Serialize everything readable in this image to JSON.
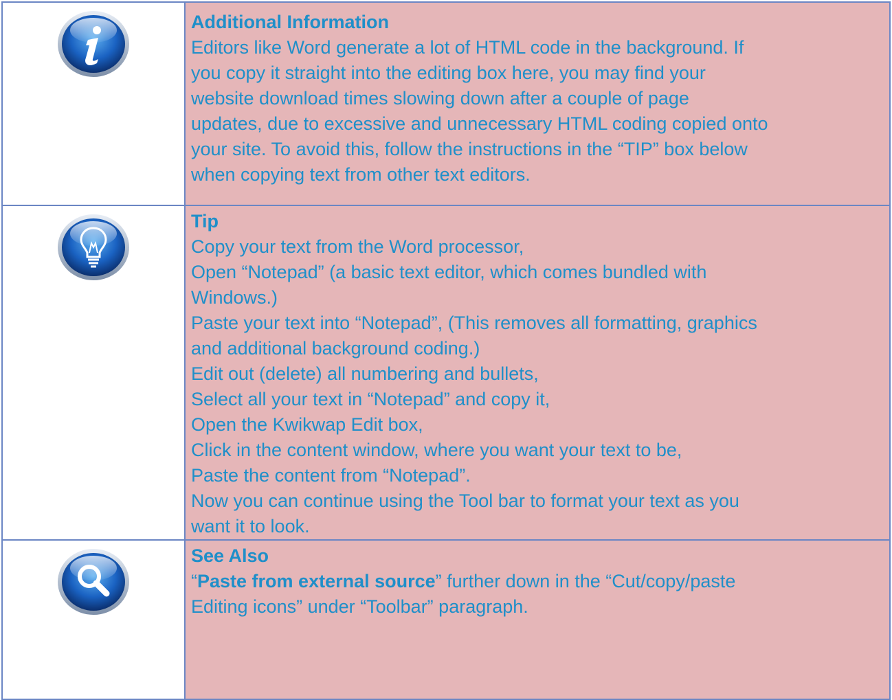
{
  "rows": [
    {
      "icon": "info-icon",
      "heading": "Additional Information",
      "lines": [
        "Editors like Word generate a lot of HTML code in the background. If",
        "you copy it straight into the editing box here, you may find your",
        "website download times slowing down after a couple of page",
        "updates, due to excessive and unnecessary HTML coding copied onto",
        "your site. To avoid this, follow the instructions in the “TIP” box below",
        "when copying text from other text editors."
      ]
    },
    {
      "icon": "lightbulb-icon",
      "heading": "Tip",
      "lines": [
        "Copy your text from the Word processor,",
        "Open “Notepad” (a basic text editor, which comes bundled with",
        "Windows.)",
        "Paste your text into “Notepad”, (This removes all formatting, graphics",
        "and additional background coding.)",
        "Edit out (delete) all numbering and bullets,",
        "Select all your text in “Notepad” and copy it,",
        "Open the Kwikwap Edit box,",
        "Click in the content window, where you want your text to be,",
        "Paste the content from “Notepad”.",
        "Now you can continue using the Tool bar to format your text as you",
        "want it to look."
      ]
    },
    {
      "icon": "magnifier-icon",
      "heading": "See Also",
      "line1_open_quote": "“",
      "line1_bold": "Paste from external source",
      "line1_rest": "” further down in the “Cut/copy/paste",
      "line2": "Editing icons” under “Toolbar” paragraph."
    }
  ],
  "colors": {
    "text": "#1f8fc9",
    "cell_background": "#e5b6b8",
    "border": "#6b86c4",
    "icon_blue": "#1a5fb4"
  }
}
